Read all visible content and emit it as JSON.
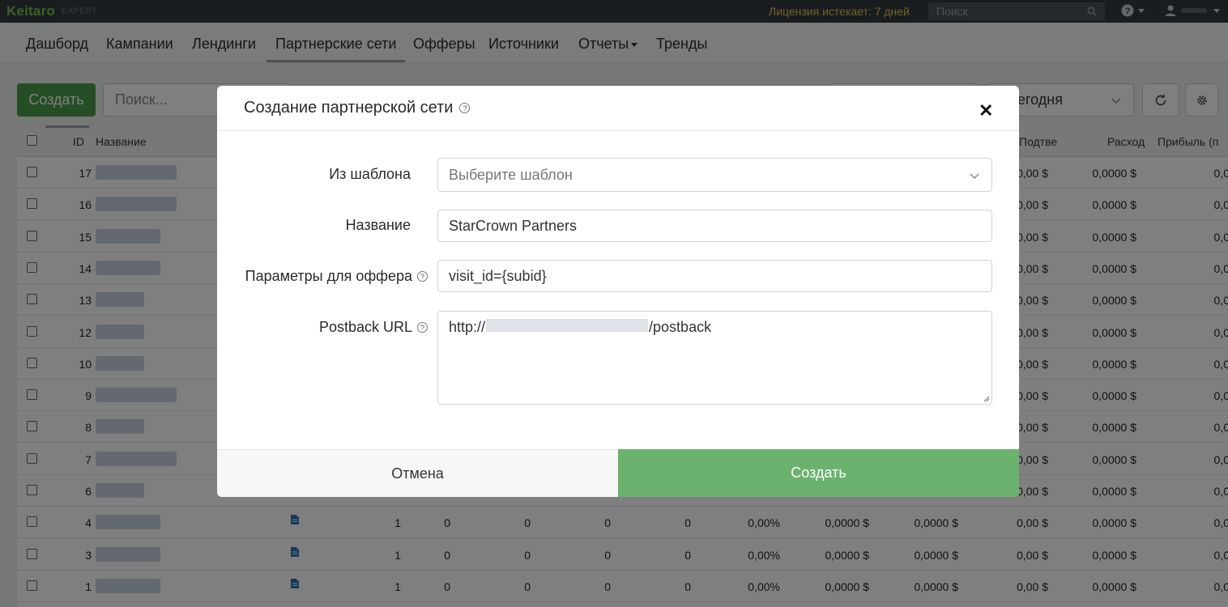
{
  "topbar": {
    "logo": "Keitaro",
    "edition": "EXPERT",
    "license": "Лицензия истекает: 7 дней",
    "search_placeholder": "Поиск"
  },
  "nav": {
    "items": [
      {
        "label": "Дашборд"
      },
      {
        "label": "Кампании"
      },
      {
        "label": "Лендинги"
      },
      {
        "label": "Партнерские сети",
        "active": true
      },
      {
        "label": "Офферы"
      },
      {
        "label": "Источники"
      },
      {
        "label": "Отчеты",
        "dropdown": true
      },
      {
        "label": "Тренды"
      }
    ]
  },
  "toolbar": {
    "create_label": "Создать",
    "search_placeholder": "Поиск...",
    "date_range": "Сегодня"
  },
  "table": {
    "headers": {
      "id": "ID",
      "name": "Название",
      "confirmed": "Подтве",
      "cost": "Расход",
      "profit": "Прибыль (п"
    },
    "rows": [
      {
        "id": "17",
        "confirmed": "0,00 $",
        "cost": "0,0000 $",
        "profit": "0,0"
      },
      {
        "id": "16",
        "confirmed": "0,00 $",
        "cost": "0,0000 $",
        "profit": "0,0"
      },
      {
        "id": "15",
        "confirmed": "0,00 $",
        "cost": "0,0000 $",
        "profit": "0,0"
      },
      {
        "id": "14",
        "confirmed": "0,00 $",
        "cost": "0,0000 $",
        "profit": "0,0"
      },
      {
        "id": "13",
        "confirmed": "0,00 $",
        "cost": "0,0000 $",
        "profit": "0,0"
      },
      {
        "id": "12",
        "confirmed": "0,00 $",
        "cost": "0,0000 $",
        "profit": "0,0"
      },
      {
        "id": "10",
        "confirmed": "0,00 $",
        "cost": "0,0000 $",
        "profit": "0,0"
      },
      {
        "id": "9",
        "confirmed": "0,00 $",
        "cost": "0,0000 $",
        "profit": "0,0"
      },
      {
        "id": "8",
        "confirmed": "0,00 $",
        "cost": "0,0000 $",
        "profit": "0,0"
      },
      {
        "id": "7",
        "confirmed": "0,00 $",
        "cost": "0,0000 $",
        "profit": "0,0"
      },
      {
        "id": "6",
        "confirmed": "0,00 $",
        "cost": "0,0000 $",
        "profit": "0,0"
      },
      {
        "id": "4",
        "c1": "1",
        "c2": "0",
        "c3": "0",
        "c4": "0",
        "c5": "0",
        "cr": "0,00%",
        "rev1": "0,0000 $",
        "rev2": "0,0000 $",
        "confirmed": "0,00 $",
        "cost": "0,0000 $",
        "profit": "0,0"
      },
      {
        "id": "3",
        "c1": "1",
        "c2": "0",
        "c3": "0",
        "c4": "0",
        "c5": "0",
        "cr": "0,00%",
        "rev1": "0,0000 $",
        "rev2": "0,0000 $",
        "confirmed": "0,00 $",
        "cost": "0,0000 $",
        "profit": "0,0"
      },
      {
        "id": "1",
        "c1": "1",
        "c2": "0",
        "c3": "0",
        "c4": "0",
        "c5": "0",
        "cr": "0,00%",
        "rev1": "0,0000 $",
        "rev2": "0,0000 $",
        "confirmed": "0,00 $",
        "cost": "0,0000 $",
        "profit": "0,0"
      }
    ]
  },
  "modal": {
    "title": "Создание партнерской сети",
    "template_label": "Из шаблона",
    "template_placeholder": "Выберите шаблон",
    "name_label": "Название",
    "name_value": "StarCrown Partners",
    "params_label": "Параметры для оффера",
    "params_value": "visit_id={subid}",
    "postback_label": "Postback URL",
    "postback_prefix": "http://",
    "postback_suffix": "/postback",
    "cancel_label": "Отмена",
    "submit_label": "Создать"
  },
  "colors": {
    "brand_green": "#7ac142",
    "create_button": "#4a9d4a",
    "submit_button": "#6ab26d",
    "license_text": "#e6c14a",
    "topbar_bg": "#323a3f"
  }
}
